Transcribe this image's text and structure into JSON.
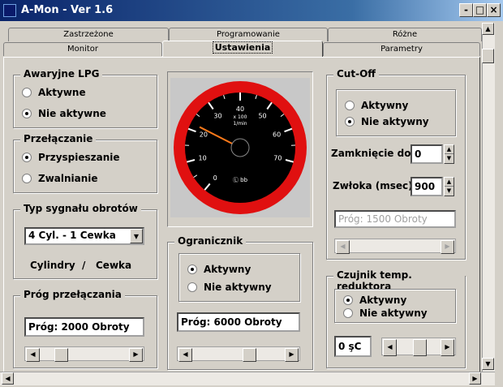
{
  "window": {
    "title": "A-Mon - Ver 1.6",
    "min": "-",
    "max": "□",
    "close": "×"
  },
  "tabs_back": [
    "Zastrzeżone",
    "Programowanie",
    "Różne"
  ],
  "tabs_front": [
    "Monitor",
    "Ustawienia",
    "Parametry"
  ],
  "awaryjne": {
    "title": "Awaryjne LPG",
    "opt1": "Aktywne",
    "opt2": "Nie aktywne",
    "selected": 2
  },
  "przelaczanie": {
    "title": "Przełączanie",
    "opt1": "Przyspieszanie",
    "opt2": "Zwalnianie",
    "selected": 1
  },
  "typ": {
    "title": "Typ sygnału obrotów",
    "value": "4 Cyl.  -  1 Cewka",
    "caption_a": "Cylindry",
    "caption_sep": "/",
    "caption_b": "Cewka"
  },
  "prog": {
    "title": "Próg przełączania",
    "value": "Próg: 2000 Obroty",
    "slider_fraction": 0.2
  },
  "gauge": {
    "ticks": [
      "0",
      "10",
      "20",
      "30",
      "40",
      "50",
      "60",
      "70"
    ],
    "unit1": "x 100",
    "unit2": "1/min",
    "brand": "Ⓛ bb",
    "needle_value": 22,
    "max": 80
  },
  "ogranicznik": {
    "title": "Ogranicznik",
    "opt1": "Aktywny",
    "opt2": "Nie aktywny",
    "selected": 1,
    "value": "Próg: 6000 Obroty",
    "slider_fraction": 0.62
  },
  "cutoff": {
    "title": "Cut-Off",
    "opt1": "Aktywny",
    "opt2": "Nie aktywny",
    "selected": 2,
    "zamk_label": "Zamknięcie do",
    "zamk_value": "0",
    "zwloka_label": "Zwłoka (msec)",
    "zwloka_value": "900",
    "prog_value": "Próg: 1500 Obroty"
  },
  "czujnik": {
    "title": "Czujnik temp. reduktora",
    "opt1": "Aktywny",
    "opt2": "Nie aktywny",
    "selected": 1,
    "temp_value": "0 şC",
    "slider_fraction": 0.5
  },
  "colors": {
    "titlebar": "#0a246a",
    "gauge_red": "#e01010",
    "gauge_face": "#000000",
    "needle": "#ff7a1a"
  }
}
